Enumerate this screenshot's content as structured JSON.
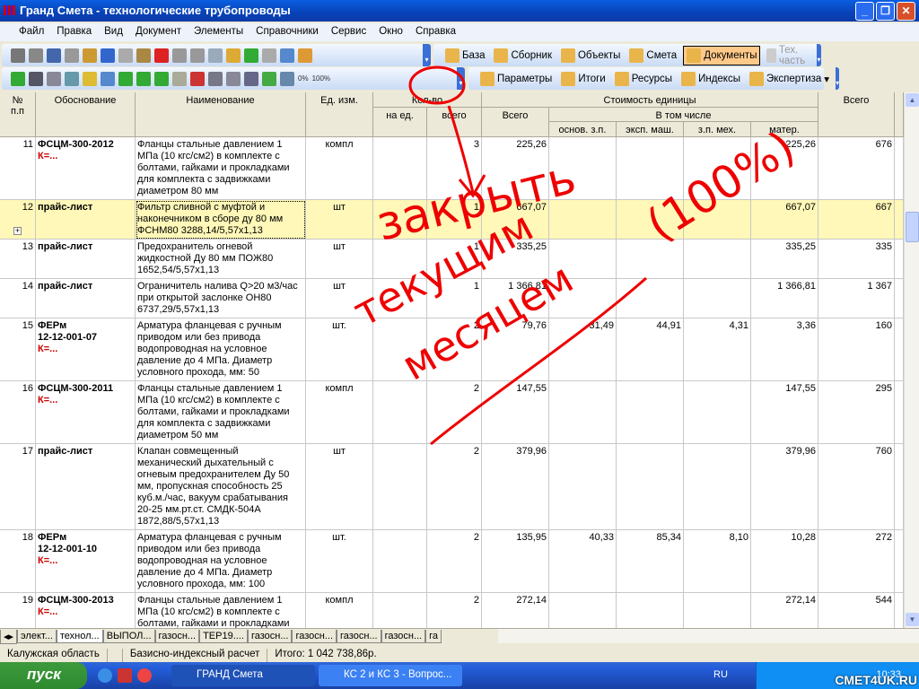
{
  "window": {
    "title": "Гранд Смета - технологические трубопроводы",
    "controls": [
      "_",
      "❐",
      "✕"
    ]
  },
  "menu": [
    "Файл",
    "Правка",
    "Вид",
    "Документ",
    "Элементы",
    "Справочники",
    "Сервис",
    "Окно",
    "Справка"
  ],
  "toolbar_right1": [
    {
      "label": "База",
      "icon": "database-icon"
    },
    {
      "label": "Сборник",
      "icon": "collection-icon"
    },
    {
      "label": "Объекты",
      "icon": "objects-icon"
    },
    {
      "label": "Смета",
      "icon": "estimate-icon"
    },
    {
      "label": "Документы",
      "icon": "documents-icon",
      "active": true
    },
    {
      "label": "Тех. часть",
      "icon": "tech-part-icon",
      "disabled": true
    }
  ],
  "toolbar_right2": [
    {
      "label": "Параметры",
      "icon": "parameters-icon"
    },
    {
      "label": "Итоги",
      "icon": "sum-icon"
    },
    {
      "label": "Ресурсы",
      "icon": "resources-icon"
    },
    {
      "label": "Индексы",
      "icon": "indexes-icon"
    },
    {
      "label": "Экспертиза",
      "icon": "expertise-icon",
      "dropdown": true
    }
  ],
  "toolbar_small": {
    "percent0": "0%",
    "percent100": "100%"
  },
  "headers": {
    "num": "№\nп.п",
    "basis": "Обоснование",
    "name": "Наименование",
    "unit": "Ед. изм.",
    "qty": "Кол-во",
    "qty_unit": "на ед.",
    "qty_total": "всего",
    "unit_cost": "Стоимость единицы",
    "total": "Всего",
    "incl": "В том числе",
    "wage": "основ. з.п.",
    "mach": "эксп. маш.",
    "mech_wage": "з.п. мех.",
    "mat": "матер.",
    "grand_total": "Всего"
  },
  "rows": [
    {
      "n": "11",
      "code": "ФСЦМ-300-2012",
      "k": "К=...",
      "name": "Фланцы стальные давлением 1 МПа (10 кгс/см2) в комплекте с болтами, гайками и прокладками для комплекта с задвижками диаметром 80 мм",
      "unit": "компл",
      "qty_unit": "",
      "qty": "3",
      "total": "225,26",
      "wage": "",
      "mach": "",
      "mech": "",
      "mat": "225,26",
      "sum": "676"
    },
    {
      "n": "12",
      "code": "прайс-лист",
      "k": "",
      "name": "Фильтр сливной с муфтой и наконечником в сборе ду 80 мм ФСНМ80   3288,14/5,57х1,13",
      "unit": "шт",
      "qty_unit": "",
      "qty": "1",
      "total": "667,07",
      "wage": "",
      "mach": "",
      "mech": "",
      "mat": "667,07",
      "sum": "667",
      "selected": true
    },
    {
      "n": "13",
      "code": "прайс-лист",
      "k": "",
      "name": "Предохранитель огневой жидкостной Ду 80 мм ПОЖ80 1652,54/5,57х1,13",
      "unit": "шт",
      "qty_unit": "",
      "qty": "1",
      "total": "335,25",
      "wage": "",
      "mach": "",
      "mech": "",
      "mat": "335,25",
      "sum": "335"
    },
    {
      "n": "14",
      "code": "прайс-лист",
      "k": "",
      "name": "Ограничитель налива Q>20 м3/час при открытой заслонке ОН80 6737,29/5,57х1,13",
      "unit": "шт",
      "qty_unit": "",
      "qty": "1",
      "total": "1 366,81",
      "wage": "",
      "mach": "",
      "mech": "",
      "mat": "1 366,81",
      "sum": "1 367"
    },
    {
      "n": "15",
      "code": "ФЕРм\n12-12-001-07",
      "k": "К=...",
      "name": "Арматура фланцевая с ручным приводом или без привода водопроводная на условное давление до 4 МПа. Диаметр условного прохода, мм: 50",
      "unit": "шт.",
      "qty_unit": "",
      "qty": "2",
      "total": "79,76",
      "wage": "31,49",
      "mach": "44,91",
      "mech": "4,31",
      "mat": "3,36",
      "sum": "160"
    },
    {
      "n": "16",
      "code": "ФСЦМ-300-2011",
      "k": "К=...",
      "name": "Фланцы стальные давлением 1 МПа (10 кгс/см2) в комплекте с болтами, гайками и прокладками для комплекта с задвижками диаметром 50 мм",
      "unit": "компл",
      "qty_unit": "",
      "qty": "2",
      "total": "147,55",
      "wage": "",
      "mach": "",
      "mech": "",
      "mat": "147,55",
      "sum": "295"
    },
    {
      "n": "17",
      "code": "прайс-лист",
      "k": "",
      "name": "Клапан совмещенный механический дыхательный с огневым предохранителем Ду 50 мм, пропускная способность 25 куб.м./час, вакуум срабатывания 20-25 мм.рт.ст. СМДК-504А 1872,88/5,57х1,13",
      "unit": "шт",
      "qty_unit": "",
      "qty": "2",
      "total": "379,96",
      "wage": "",
      "mach": "",
      "mech": "",
      "mat": "379,96",
      "sum": "760"
    },
    {
      "n": "18",
      "code": "ФЕРм\n12-12-001-10",
      "k": "К=...",
      "name": "Арматура фланцевая с ручным приводом или без привода водопроводная на условное давление до 4 МПа. Диаметр условного прохода, мм: 100",
      "unit": "шт.",
      "qty_unit": "",
      "qty": "2",
      "total": "135,95",
      "wage": "40,33",
      "mach": "85,34",
      "mech": "8,10",
      "mat": "10,28",
      "sum": "272"
    },
    {
      "n": "19",
      "code": "ФСЦМ-300-2013",
      "k": "К=...",
      "name": "Фланцы стальные давлением 1 МПа (10 кгс/см2) в комплекте с болтами, гайками и прокладками для",
      "unit": "компл",
      "qty_unit": "",
      "qty": "2",
      "total": "272,14",
      "wage": "",
      "mach": "",
      "mech": "",
      "mat": "272,14",
      "sum": "544"
    }
  ],
  "sheet_tabs": [
    "элект...",
    "технол...",
    "ВЫПОЛ...",
    "газосн...",
    "ТЕР19....",
    "газосн...",
    "газосн...",
    "газосн...",
    "газосн...",
    "га"
  ],
  "active_sheet": 1,
  "status": {
    "region": "Калужская область",
    "method": "Базисно-индексный расчет",
    "total": "Итого: 1 042 738,86р."
  },
  "taskbar": {
    "start": "пуск",
    "tasks": [
      "ГРАНД Смета",
      "КС 2 и КС 3 - Вопрос..."
    ],
    "lang": "RU",
    "time": "10:33",
    "watermark": "СМЕТ4UK.RU"
  },
  "annotation": {
    "text_line1": "закрыть",
    "text_line2": "текущим",
    "text_line3": "месяцем",
    "text_paren": "(100%)",
    "color": "#e00000"
  }
}
